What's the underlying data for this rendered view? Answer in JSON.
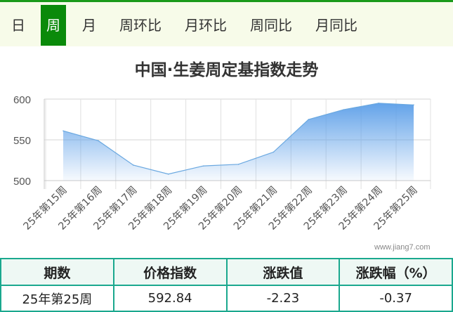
{
  "tabs": [
    {
      "label": "日",
      "active": false
    },
    {
      "label": "周",
      "active": true
    },
    {
      "label": "月",
      "active": false
    },
    {
      "label": "周环比",
      "active": false
    },
    {
      "label": "月环比",
      "active": false
    },
    {
      "label": "周同比",
      "active": false
    },
    {
      "label": "月同比",
      "active": false
    }
  ],
  "chart_title": "中国·生姜周定基指数走势",
  "watermark": "www.jiang7.com",
  "chart_data": {
    "type": "area",
    "title": "中国·生姜周定基指数走势",
    "categories": [
      "25年第15周",
      "25年第16周",
      "25年第17周",
      "25年第18周",
      "25年第19周",
      "25年第20周",
      "25年第21周",
      "25年第22周",
      "25年第23周",
      "25年第24周",
      "25年第25周"
    ],
    "values": [
      561,
      549,
      519,
      508,
      518,
      520,
      535,
      575,
      587,
      595,
      592.84
    ],
    "ylim": [
      500,
      600
    ],
    "yticks": [
      500,
      550,
      600
    ],
    "grid": true,
    "fill_color": "#5b9ee8",
    "line_color": "#6aa8e0"
  },
  "table": {
    "headers": [
      "期数",
      "价格指数",
      "涨跌值",
      "涨跌幅（%）"
    ],
    "row": [
      "25年第25周",
      "592.84",
      "-2.23",
      "-0.37"
    ]
  },
  "colors": {
    "tab_active": "#0a8a0a",
    "tab_bar_border": "#1a9a1a",
    "table_border": "#1aa88e"
  }
}
